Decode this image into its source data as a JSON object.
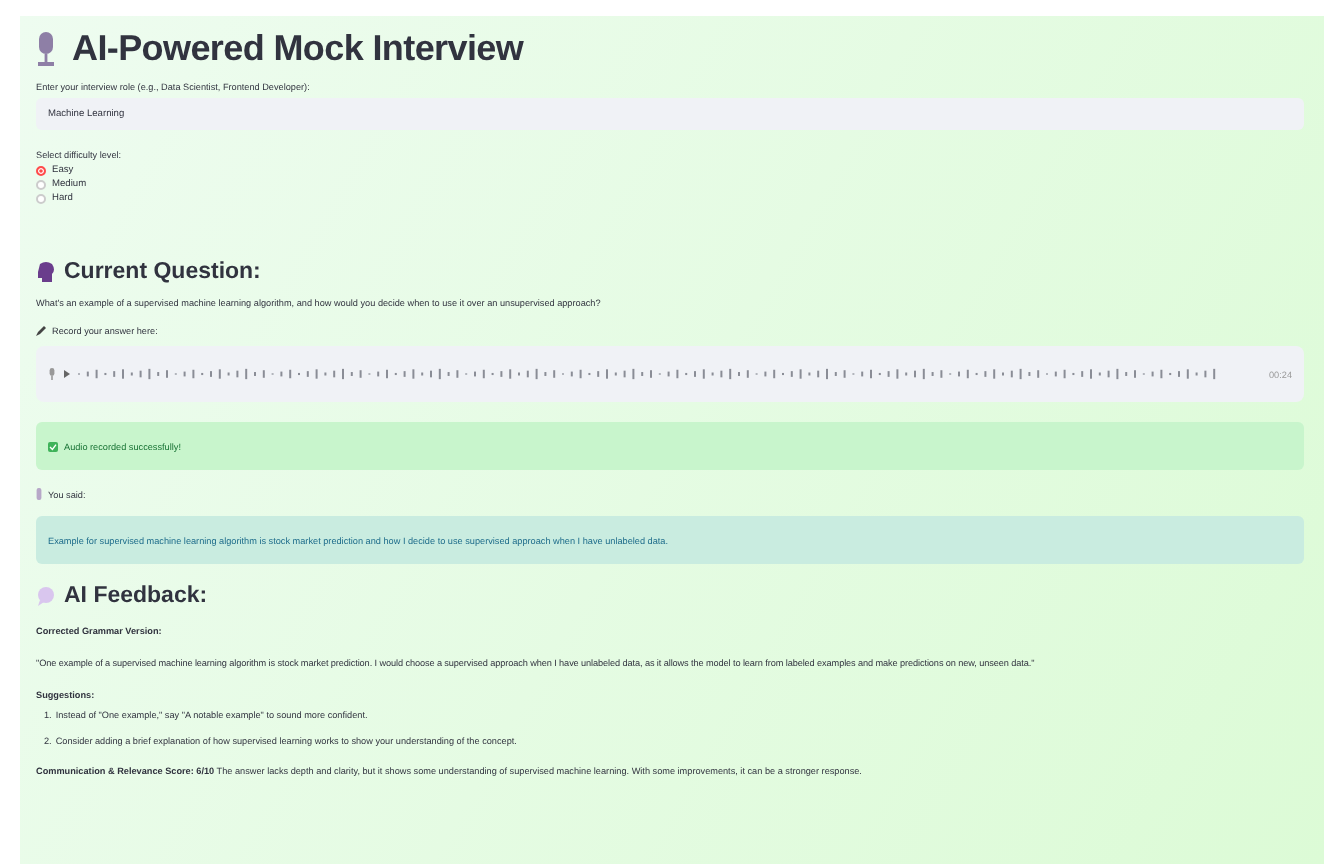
{
  "title": "AI-Powered Mock Interview",
  "role_field": {
    "label": "Enter your interview role (e.g., Data Scientist, Frontend Developer):",
    "value": "Machine Learning"
  },
  "difficulty": {
    "label": "Select difficulty level:",
    "options": [
      {
        "label": "Easy",
        "selected": true
      },
      {
        "label": "Medium",
        "selected": false
      },
      {
        "label": "Hard",
        "selected": false
      }
    ]
  },
  "question": {
    "heading": "Current Question:",
    "text": "What's an example of a supervised machine learning algorithm, and how would you decide when to use it over an unsupervised approach?"
  },
  "recorder": {
    "label": "Record your answer here:",
    "time": "00:24"
  },
  "success": {
    "text": "Audio recorded successfully!"
  },
  "transcript": {
    "label": "You said:",
    "text": "Example for supervised machine learning algorithm is stock market prediction and how I decide to use supervised approach when I have unlabeled data."
  },
  "feedback": {
    "heading": "AI Feedback:",
    "grammar_label": "Corrected Grammar Version:",
    "grammar_text": "\"One example of a supervised machine learning algorithm is stock market prediction. I would choose a supervised approach when I have unlabeled data, as it allows the model to learn from labeled examples and make predictions on new, unseen data.\"",
    "suggestions_label": "Suggestions:",
    "suggestions": [
      {
        "number": "1.",
        "text": "Instead of \"One example,\" say \"A notable example\" to sound more confident."
      },
      {
        "number": "2.",
        "text": "Consider adding a brief explanation of how supervised learning works to show your understanding of the concept."
      }
    ],
    "score": "**Communication & Relevance Score: 6/10** The answer lacks depth and clarity, but it shows some understanding of supervised machine learning. With some improvements, it can be a stronger response."
  }
}
